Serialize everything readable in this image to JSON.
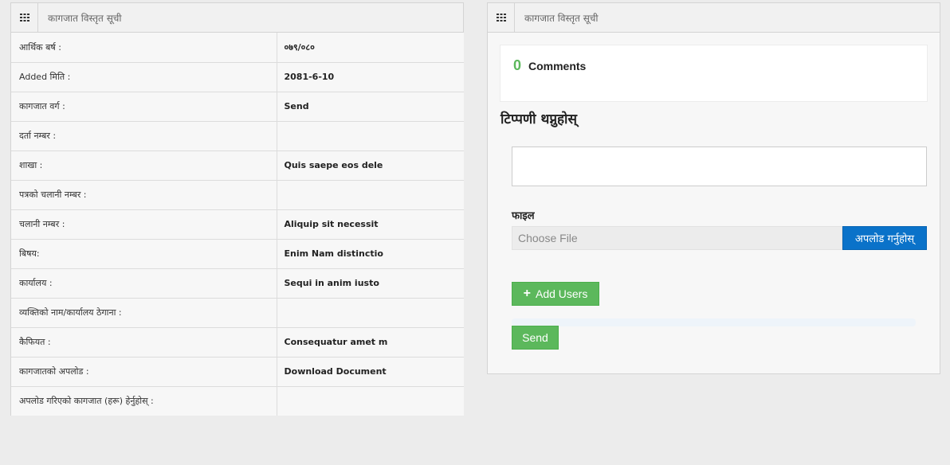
{
  "left_panel": {
    "title": "कागजात विस्तृत सूची",
    "rows": [
      {
        "label": "आर्थिक बर्ष :",
        "value": "०७९/०८०"
      },
      {
        "label": "Added मिति :",
        "value": "2081-6-10"
      },
      {
        "label": "कागजात वर्ग :",
        "value": "Send"
      },
      {
        "label": "दर्ता नम्बर :",
        "value": ""
      },
      {
        "label": "शाखा :",
        "value": "Quis saepe eos dele"
      },
      {
        "label": "पत्रको चलानी नम्बर :",
        "value": ""
      },
      {
        "label": "चलानी नम्बर :",
        "value": "Aliquip sit necessit"
      },
      {
        "label": "बिषय:",
        "value": "Enim Nam distinctio"
      },
      {
        "label": "कार्यालय :",
        "value": "Sequi in anim iusto"
      },
      {
        "label": "व्यक्तिको नाम/कार्यालय ठेगाना :",
        "value": ""
      },
      {
        "label": "कैफियत :",
        "value": "Consequatur amet m"
      },
      {
        "label": "कागजातको अपलोड :",
        "value": "Download Document"
      },
      {
        "label": "अपलोड गरिएको कागजात (हरू) हेर्नुहोस् :",
        "value": ""
      }
    ]
  },
  "right_panel": {
    "title": "कागजात विस्तृत सूची",
    "comments": {
      "count": "0",
      "label": "Comments"
    },
    "add_comment_heading": "टिप्पणी थप्नुहोस्",
    "comment_textarea": {
      "value": "",
      "placeholder": ""
    },
    "file_label": "फाइल",
    "file_input_text": "Choose File",
    "upload_button_label": "अपलोड गर्नुहोस्",
    "add_users_button_label": "Add Users",
    "send_button_label": "Send"
  },
  "icons": {
    "panel_header_icon": "grid-icon",
    "add_users_icon": "plus-icon"
  },
  "colors": {
    "primary_blue": "#0a72c9",
    "success_green": "#5cb85c",
    "background": "#ececec"
  }
}
